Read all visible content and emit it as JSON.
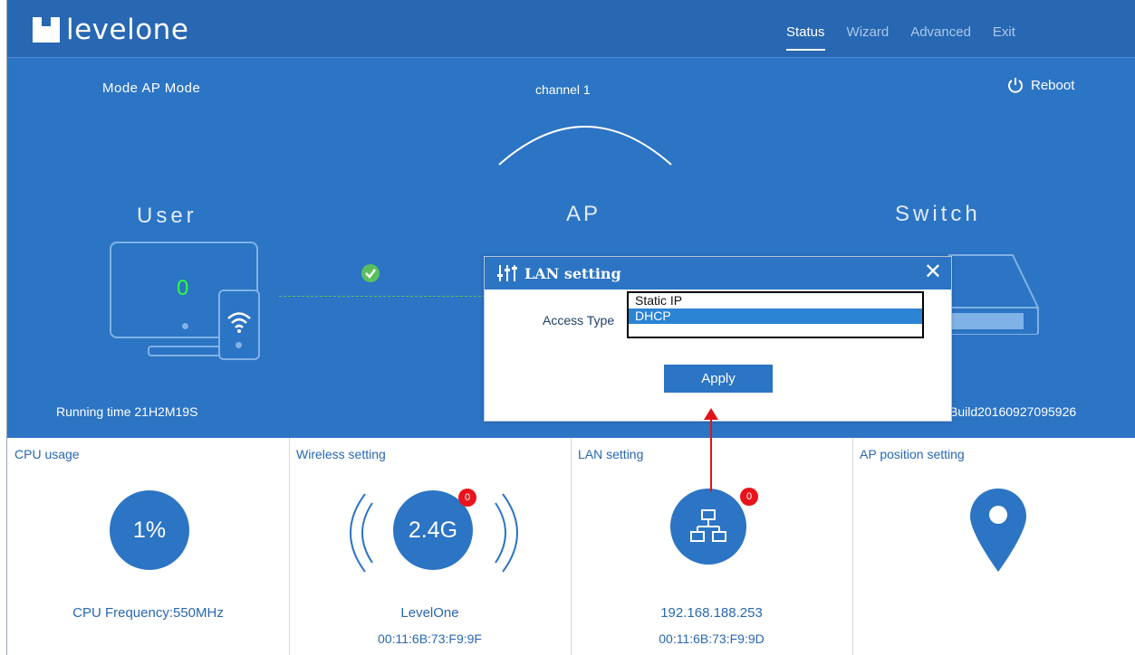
{
  "header": {
    "brand": "levelone",
    "nav": [
      {
        "label": "Status",
        "active": true
      },
      {
        "label": "Wizard",
        "active": false
      },
      {
        "label": "Advanced",
        "active": false
      },
      {
        "label": "Exit",
        "active": false
      }
    ]
  },
  "status": {
    "mode_text": "Mode  AP Mode",
    "channel_text": "channel 1",
    "reboot_label": "Reboot",
    "user_label": "User",
    "ap_label": "AP",
    "switch_label": "Switch",
    "user_count": "0",
    "running_time": "Running time  21H2M19S",
    "build": "Build20160927095926"
  },
  "dialog": {
    "title": "LAN setting",
    "access_type_label": "Access Type",
    "options": [
      "Static IP",
      "DHCP"
    ],
    "selected": "DHCP",
    "apply_label": "Apply"
  },
  "panels": {
    "cpu": {
      "title": "CPU usage",
      "value": "1%",
      "freq": "CPU Frequency:550MHz"
    },
    "wireless": {
      "title": "Wireless setting",
      "band": "2.4G",
      "badge": "0",
      "ssid": "LevelOne",
      "mac": "00:11:6B:73:F9:9F"
    },
    "lan": {
      "title": "LAN setting",
      "badge": "0",
      "ip": "192.168.188.253",
      "mac": "00:11:6B:73:F9:9D"
    },
    "ap_position": {
      "title": "AP position setting"
    }
  },
  "colors": {
    "primary": "#2c74c4",
    "header": "#2867b2",
    "badge": "#e9131b",
    "annotation_arrow": "#e3131b",
    "check": "#5ac05d"
  }
}
